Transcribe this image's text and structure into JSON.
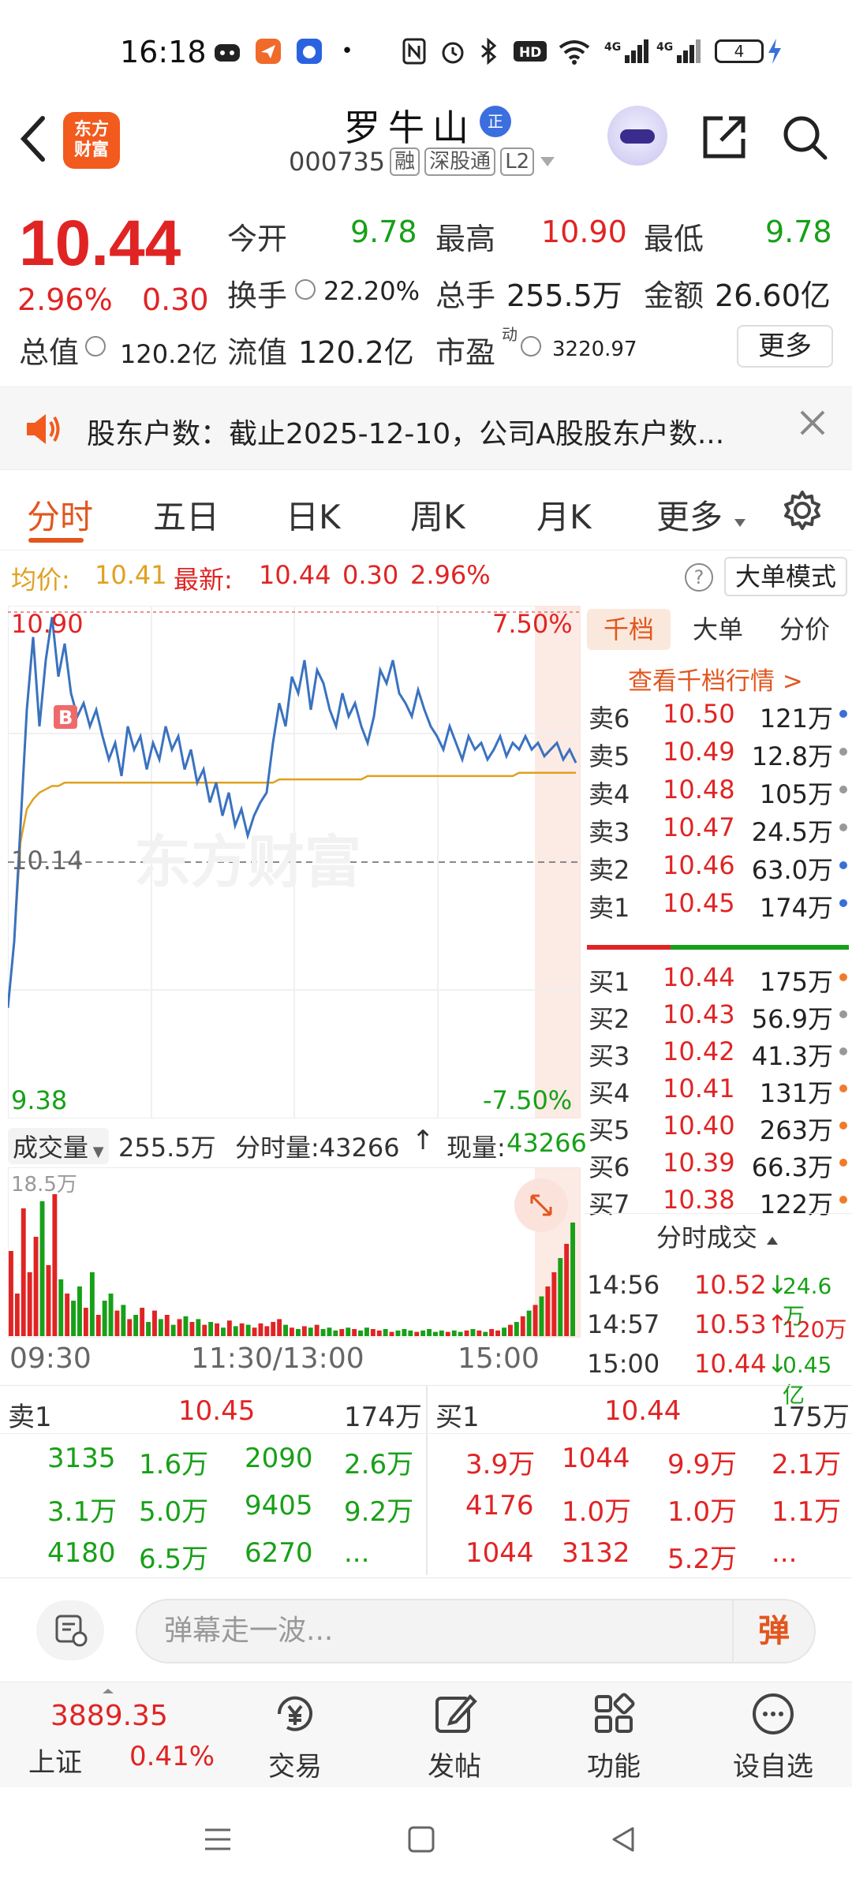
{
  "status_bar": {
    "time": "16:18",
    "battery": "4",
    "hd_label": "HD",
    "net_label_1": "4G",
    "net_label_2": "4G"
  },
  "header": {
    "logo_line1": "东方",
    "logo_line2": "财富",
    "stock_name": "罗牛山",
    "badge": "正",
    "stock_code": "000735",
    "tags": [
      "融",
      "深股通",
      "L2"
    ]
  },
  "quote": {
    "price": "10.44",
    "change_pct": "2.96%",
    "change": "0.30",
    "open_label": "今开",
    "open": "9.78",
    "high_label": "最高",
    "high": "10.90",
    "low_label": "最低",
    "low": "9.78",
    "turnover_label": "换手",
    "turnover": "22.20%",
    "volume_label": "总手",
    "volume": "255.5万",
    "amount_label": "金额",
    "amount": "26.60亿",
    "mktcap_label": "总值",
    "mktcap": "120.2亿",
    "float_label": "流值",
    "float": "120.2亿",
    "pe_label": "市盈",
    "pe_sup": "动",
    "pe": "3220.97",
    "more_label": "更多"
  },
  "announcement": {
    "text": "股东户数：截止2025-12-10，公司A股股东户数..."
  },
  "tabs": [
    "分时",
    "五日",
    "日K",
    "周K",
    "月K",
    "更多"
  ],
  "avg_line": {
    "avg_label": "均价:",
    "avg": "10.41",
    "latest_label": "最新:",
    "latest": "10.44",
    "chg": "0.30",
    "pct": "2.96%",
    "bigmode_label": "大单模式"
  },
  "chart_labels": {
    "top_price": "10.90",
    "top_pct": "7.50%",
    "mid_price": "10.14",
    "bottom_price": "9.38",
    "bottom_pct": "-7.50%",
    "b_marker": "B",
    "watermark": "东方财富"
  },
  "volume_panel": {
    "label": "成交量",
    "total": "255.5万",
    "tick_label": "分时量:43266",
    "now_label": "现量:",
    "now": "43266",
    "max_label": "18.5万",
    "x_labels": [
      "09:30",
      "11:30/13:00",
      "15:00"
    ]
  },
  "orderbook": {
    "tabs": [
      "千档",
      "大单",
      "分价"
    ],
    "link": "查看千档行情 >",
    "asks": [
      {
        "label": "卖6",
        "price": "10.50",
        "vol": "121万",
        "dot": "#3a6fd8"
      },
      {
        "label": "卖5",
        "price": "10.49",
        "vol": "12.8万",
        "dot": "#999999"
      },
      {
        "label": "卖4",
        "price": "10.48",
        "vol": "105万",
        "dot": "#999999"
      },
      {
        "label": "卖3",
        "price": "10.47",
        "vol": "24.5万",
        "dot": "#999999"
      },
      {
        "label": "卖2",
        "price": "10.46",
        "vol": "63.0万",
        "dot": "#3a6fd8"
      },
      {
        "label": "卖1",
        "price": "10.45",
        "vol": "174万",
        "dot": "#3a6fd8"
      }
    ],
    "bids": [
      {
        "label": "买1",
        "price": "10.44",
        "vol": "175万",
        "dot": "#f07b2a"
      },
      {
        "label": "买2",
        "price": "10.43",
        "vol": "56.9万",
        "dot": "#999999"
      },
      {
        "label": "买3",
        "price": "10.42",
        "vol": "41.3万",
        "dot": "#999999"
      },
      {
        "label": "买4",
        "price": "10.41",
        "vol": "131万",
        "dot": "#f07b2a"
      },
      {
        "label": "买5",
        "price": "10.40",
        "vol": "263万",
        "dot": "#f07b2a"
      },
      {
        "label": "买6",
        "price": "10.39",
        "vol": "66.3万",
        "dot": "#f07b2a"
      },
      {
        "label": "买7",
        "price": "10.38",
        "vol": "122万",
        "dot": "#f07b2a"
      }
    ],
    "trades_title": "分时成交",
    "trades": [
      {
        "time": "14:56",
        "price": "10.52",
        "arrow": "↓",
        "vol": "24.6万"
      },
      {
        "time": "14:57",
        "price": "10.53",
        "arrow": "↑",
        "vol": "120万"
      },
      {
        "time": "15:00",
        "price": "10.44",
        "arrow": "↓",
        "vol": "0.45亿"
      }
    ]
  },
  "tape": {
    "sell_label": "卖1",
    "sell_price": "10.45",
    "sell_vol": "174万",
    "buy_label": "买1",
    "buy_price": "10.44",
    "buy_vol": "175万",
    "sell_rows": [
      [
        "3135",
        "1.6万",
        "2090",
        "2.6万"
      ],
      [
        "3.1万",
        "5.0万",
        "9405",
        "9.2万"
      ],
      [
        "4180",
        "6.5万",
        "6270",
        "..."
      ]
    ],
    "buy_rows": [
      [
        "3.9万",
        "1044",
        "9.9万",
        "2.1万"
      ],
      [
        "4176",
        "1.0万",
        "1.0万",
        "1.1万"
      ],
      [
        "1044",
        "3132",
        "5.2万",
        "..."
      ]
    ]
  },
  "comment": {
    "placeholder": "弹幕走一波...",
    "danmu": "弹"
  },
  "bottom_bar": {
    "index_value": "3889.35",
    "index_name": "上证",
    "index_pct": "0.41%",
    "items": [
      "交易",
      "发帖",
      "功能",
      "设自选"
    ]
  },
  "chart_data": {
    "type": "line",
    "title": "",
    "ylim": [
      9.38,
      10.9
    ],
    "x_labels": [
      "09:30",
      "11:30/13:00",
      "15:00"
    ],
    "series": [
      {
        "values": [
          9.7,
          9.9,
          10.25,
          10.6,
          10.82,
          10.55,
          10.75,
          10.88,
          10.7,
          10.8,
          10.65,
          10.58,
          10.62,
          10.55,
          10.6,
          10.52,
          10.45,
          10.5,
          10.4,
          10.55,
          10.48,
          10.52,
          10.42,
          10.5,
          10.45,
          10.55,
          10.48,
          10.52,
          10.42,
          10.48,
          10.38,
          10.42,
          10.32,
          10.38,
          10.28,
          10.35,
          10.25,
          10.3,
          10.22,
          10.28,
          10.32,
          10.35,
          10.5,
          10.62,
          10.55,
          10.7,
          10.65,
          10.75,
          10.6,
          10.72,
          10.68,
          10.6,
          10.55,
          10.65,
          10.58,
          10.62,
          10.55,
          10.5,
          10.58,
          10.72,
          10.68,
          10.75,
          10.65,
          10.62,
          10.58,
          10.66,
          10.6,
          10.55,
          10.52,
          10.48,
          10.55,
          10.5,
          10.45,
          10.52,
          10.48,
          10.5,
          10.45,
          10.48,
          10.52,
          10.46,
          10.5,
          10.48,
          10.52,
          10.48,
          10.5,
          10.46,
          10.48,
          10.5,
          10.45,
          10.48,
          10.44
        ]
      },
      {
        "values": [
          9.7,
          9.9,
          10.2,
          10.3,
          10.33,
          10.35,
          10.36,
          10.37,
          10.37,
          10.38,
          10.38,
          10.38,
          10.38,
          10.38,
          10.38,
          10.38,
          10.38,
          10.38,
          10.38,
          10.38,
          10.38,
          10.38,
          10.38,
          10.38,
          10.38,
          10.38,
          10.38,
          10.38,
          10.38,
          10.38,
          10.38,
          10.38,
          10.38,
          10.38,
          10.38,
          10.38,
          10.38,
          10.38,
          10.38,
          10.38,
          10.38,
          10.38,
          10.38,
          10.39,
          10.39,
          10.39,
          10.39,
          10.39,
          10.39,
          10.39,
          10.39,
          10.39,
          10.39,
          10.39,
          10.39,
          10.39,
          10.39,
          10.4,
          10.4,
          10.4,
          10.4,
          10.4,
          10.4,
          10.4,
          10.4,
          10.4,
          10.4,
          10.4,
          10.4,
          10.4,
          10.4,
          10.4,
          10.4,
          10.4,
          10.4,
          10.4,
          10.4,
          10.4,
          10.4,
          10.4,
          10.4,
          10.41,
          10.41,
          10.41,
          10.41,
          10.41,
          10.41,
          10.41,
          10.41,
          10.41,
          10.41
        ]
      }
    ],
    "volume": [
      60,
      30,
      90,
      45,
      70,
      95,
      50,
      100,
      40,
      30,
      25,
      35,
      20,
      45,
      15,
      25,
      30,
      18,
      22,
      12,
      15,
      20,
      10,
      18,
      12,
      15,
      8,
      12,
      14,
      10,
      12,
      8,
      10,
      9,
      6,
      11,
      7,
      9,
      8,
      6,
      9,
      7,
      10,
      12,
      8,
      6,
      5,
      7,
      6,
      8,
      5,
      6,
      4,
      5,
      6,
      5,
      4,
      6,
      5,
      4,
      5,
      3,
      4,
      5,
      4,
      3,
      4,
      5,
      3,
      4,
      3,
      4,
      3,
      4,
      5,
      4,
      3,
      5,
      4,
      6,
      8,
      10,
      14,
      18,
      22,
      28,
      35,
      45,
      55,
      65,
      80
    ]
  }
}
